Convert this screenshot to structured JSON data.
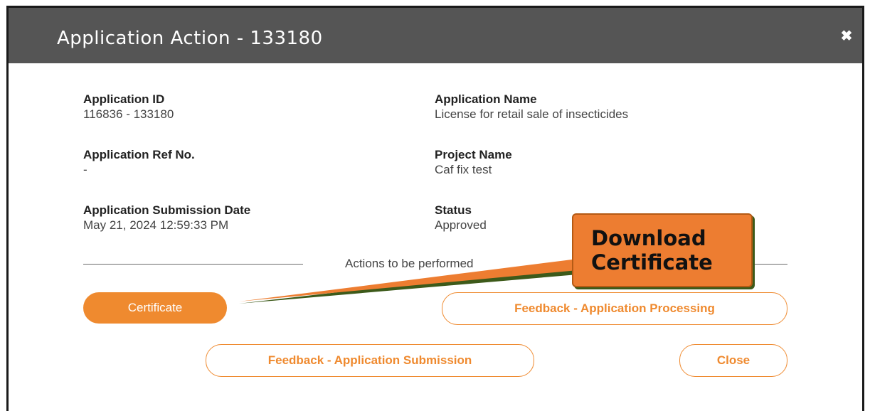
{
  "modal": {
    "title": "Application Action - 133180",
    "close_icon": "close-icon"
  },
  "fields": {
    "application_id": {
      "label": "Application ID",
      "value": "116836 - 133180"
    },
    "application_name": {
      "label": "Application Name",
      "value": "License for retail sale of insecticides"
    },
    "ref_no": {
      "label": "Application Ref No.",
      "value": "-"
    },
    "project_name": {
      "label": "Project Name",
      "value": "Caf fix test"
    },
    "submission_date": {
      "label": "Application Submission Date",
      "value": "May 21, 2024 12:59:33 PM"
    },
    "status": {
      "label": "Status",
      "value": "Approved"
    }
  },
  "actions": {
    "heading": "Actions to be performed",
    "certificate": "Certificate",
    "feedback_processing": "Feedback - Application Processing",
    "feedback_submission": "Feedback - Application Submission",
    "close": "Close"
  },
  "callout": {
    "text_line1": "Download",
    "text_line2": "Certificate"
  },
  "colors": {
    "header_bg": "#555555",
    "accent": "#ef8a2f",
    "callout_bg": "#ed7d31",
    "arrow_dark": "#3d5a1a"
  }
}
